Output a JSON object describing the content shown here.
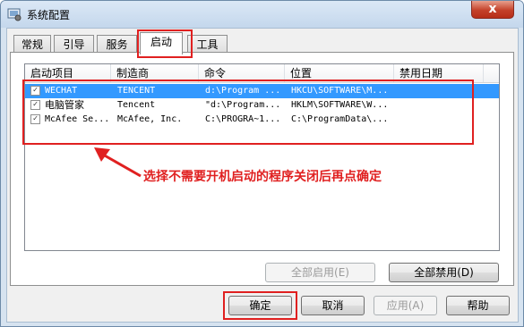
{
  "window": {
    "title": "系统配置",
    "close_label": "x"
  },
  "tabs": [
    {
      "label": "常规"
    },
    {
      "label": "引导"
    },
    {
      "label": "服务"
    },
    {
      "label": "启动"
    },
    {
      "label": "工具"
    }
  ],
  "startup_table": {
    "columns": [
      "启动项目",
      "制造商",
      "命令",
      "位置",
      "禁用日期"
    ],
    "rows": [
      {
        "checked": true,
        "name": "WECHAT",
        "maker": "TENCENT",
        "command": "d:\\Program ...",
        "location": "HKCU\\SOFTWARE\\M...",
        "disabled_date": ""
      },
      {
        "checked": true,
        "name": "电脑管家",
        "maker": "Tencent",
        "command": "\"d:\\Program...",
        "location": "HKLM\\SOFTWARE\\W...",
        "disabled_date": ""
      },
      {
        "checked": true,
        "name": "McAfee Se...",
        "maker": "McAfee, Inc.",
        "command": "C:\\PROGRA~1...",
        "location": "C:\\ProgramData\\...",
        "disabled_date": ""
      }
    ]
  },
  "annotation": {
    "text": "选择不需要开机启动的程序关闭后再点确定",
    "color": "#e02020"
  },
  "buttons": {
    "enable_all": "全部启用(E)",
    "disable_all": "全部禁用(D)",
    "ok": "确定",
    "cancel": "取消",
    "apply": "应用(A)",
    "help": "帮助"
  },
  "colors": {
    "selection": "#3399ff",
    "annotation": "#e02020",
    "close_button": "#c4412a"
  }
}
